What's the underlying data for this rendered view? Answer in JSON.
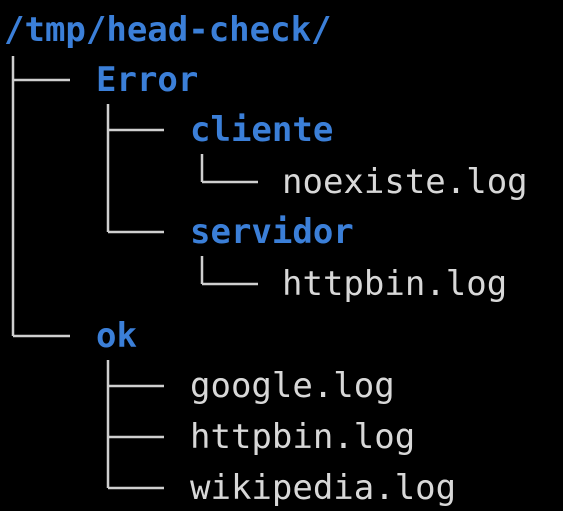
{
  "terminal": {
    "root_path": "/tmp/head-check/",
    "entries": [
      {
        "name": "Error",
        "kind": "directory"
      },
      {
        "name": "cliente",
        "kind": "directory"
      },
      {
        "name": "noexiste.log",
        "kind": "file"
      },
      {
        "name": "servidor",
        "kind": "directory"
      },
      {
        "name": "httpbin.log",
        "kind": "file"
      },
      {
        "name": "ok",
        "kind": "directory"
      },
      {
        "name": "google.log",
        "kind": "file"
      },
      {
        "name": "httpbin.log",
        "kind": "file"
      },
      {
        "name": "wikipedia.log",
        "kind": "file"
      }
    ]
  },
  "colors": {
    "background": "#000000",
    "directory": "#3b7fd8",
    "file": "#d8d8d8",
    "connector": "#cfcfcf"
  }
}
